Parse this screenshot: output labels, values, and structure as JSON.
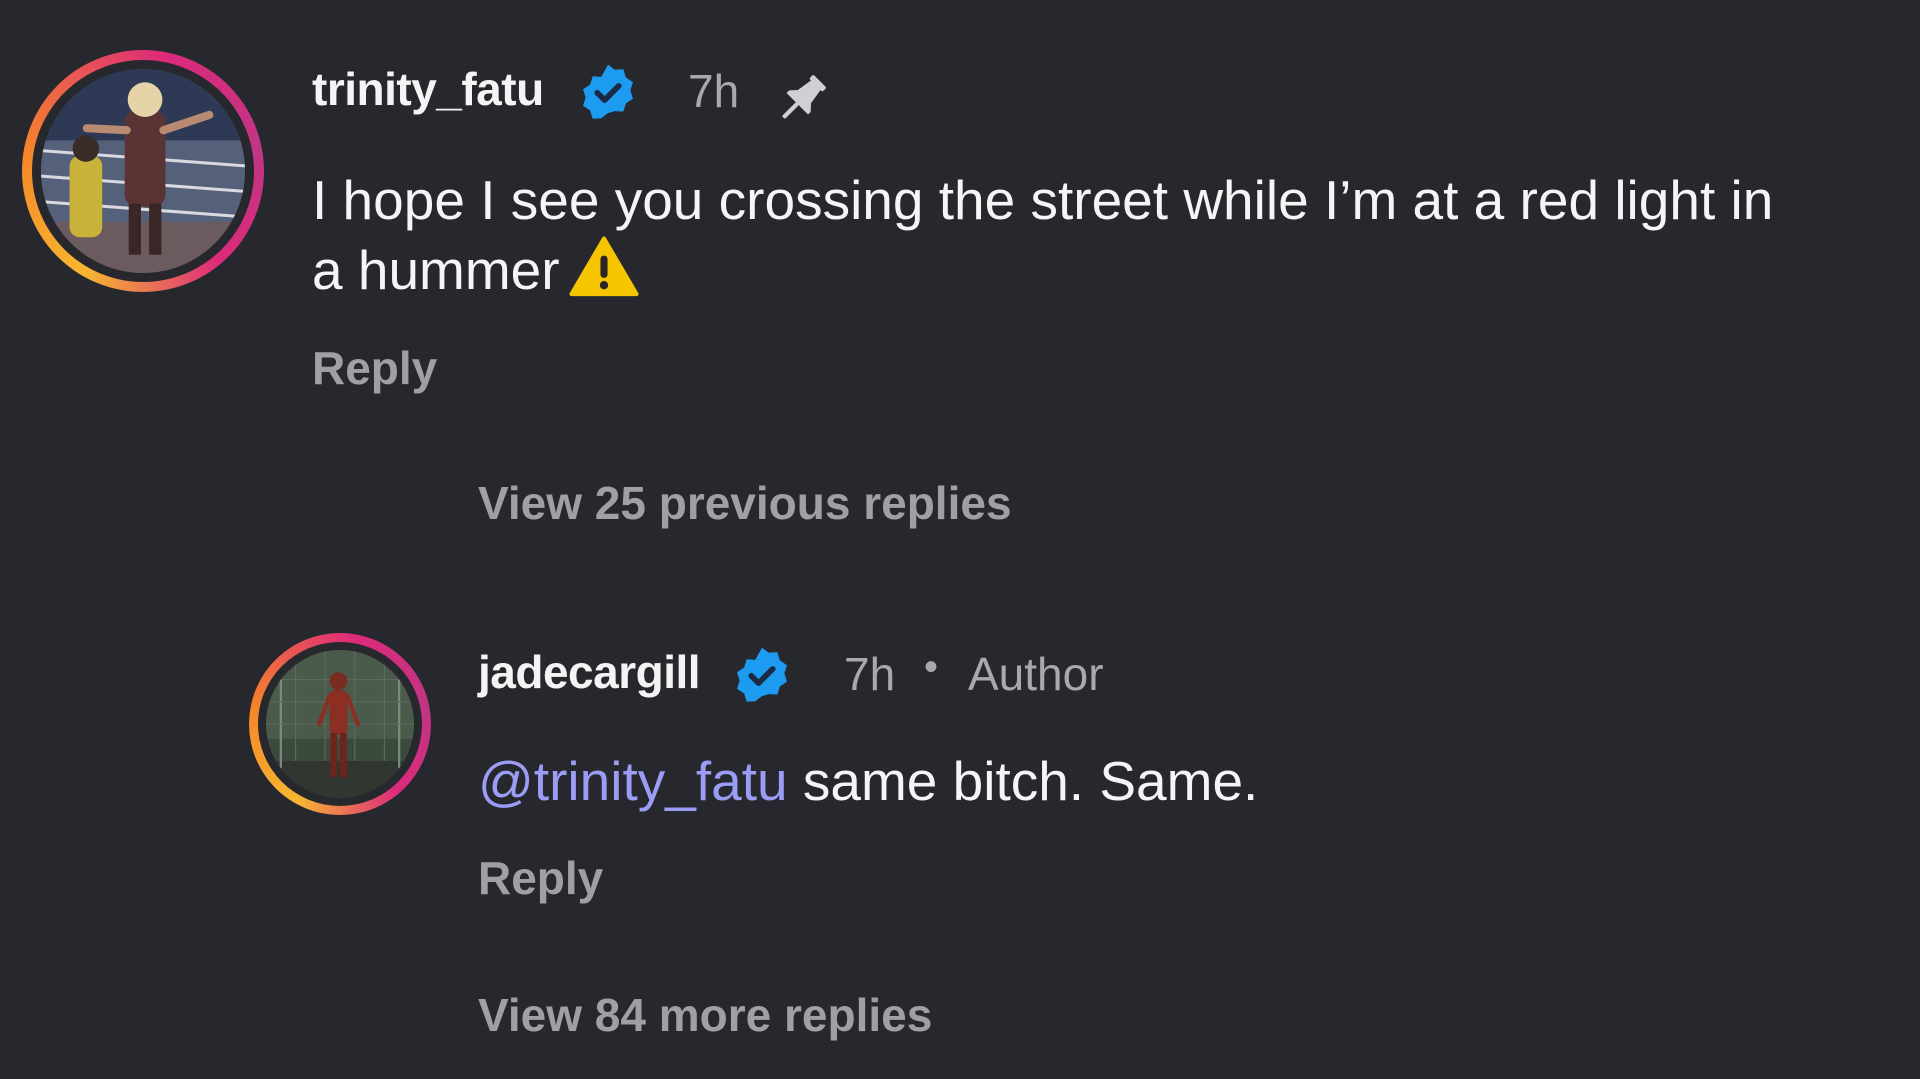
{
  "comment": {
    "username": "trinity_fatu",
    "time": "7h",
    "text_line1": "I hope I see you crossing the street while I’m at a red light in",
    "text_line2": "a hummer",
    "reply_label": "Reply",
    "icons": {
      "verified": "verified-badge-icon",
      "pin": "pin-icon",
      "emoji": "warning-emoji-icon"
    }
  },
  "thread": {
    "view_previous_label": "View 25 previous replies",
    "view_more_label": "View 84 more replies"
  },
  "reply": {
    "username": "jadecargill",
    "time": "7h",
    "separator": "•",
    "author_label": "Author",
    "mention": "@trinity_fatu",
    "text": " same bitch. Same.",
    "reply_label": "Reply"
  },
  "colors": {
    "background": "#26282d",
    "verified_blue": "#1d9bf0",
    "mention": "#9b9cf4",
    "secondary_text": "#a8a9ae"
  }
}
